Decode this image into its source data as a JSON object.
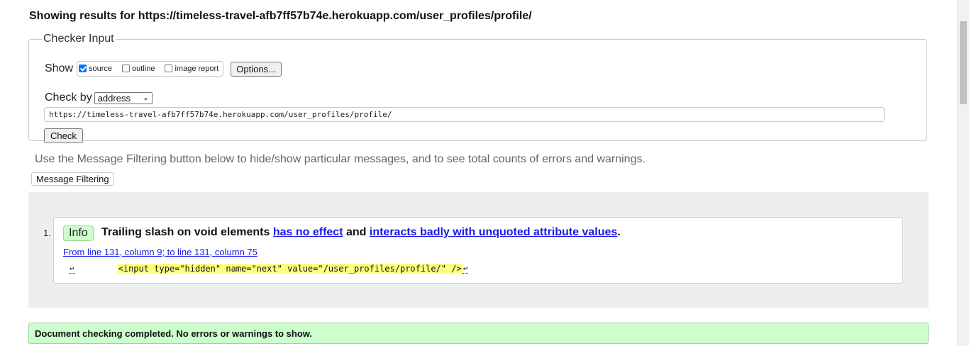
{
  "heading": {
    "prefix": "Showing results for ",
    "url": "https://timeless-travel-afb7ff57b74e.herokuapp.com/user_profiles/profile/"
  },
  "checker": {
    "legend": "Checker Input",
    "show_label": "Show",
    "options": [
      {
        "label": "source",
        "checked": true
      },
      {
        "label": "outline",
        "checked": false
      },
      {
        "label": "image report",
        "checked": false
      }
    ],
    "options_button": "Options...",
    "check_by_label": "Check by",
    "check_by_value": "address",
    "url_value": "https://timeless-travel-afb7ff57b74e.herokuapp.com/user_profiles/profile/",
    "check_button": "Check"
  },
  "filter": {
    "note": "Use the Message Filtering button below to hide/show particular messages, and to see total counts of errors and warnings.",
    "button": "Message Filtering"
  },
  "messages": [
    {
      "number": "1.",
      "type": "Info",
      "text_before": "Trailing slash on void elements ",
      "link1": "has no effect",
      "text_middle": " and ",
      "link2": "interacts badly with unquoted attribute values",
      "text_after": ".",
      "location": "From line 131, column 9; to line 131, column 75",
      "extract_newline": "↩",
      "extract_code": "<input type=\"hidden\" name=\"next\" value=\"/user_profiles/profile/\" />",
      "extract_newline_end": "↩"
    }
  ],
  "result": {
    "done_text": "Document checking completed. No errors or warnings to show."
  },
  "colors": {
    "info_badge_bg": "#ccffcc",
    "link": "#1a1ae6",
    "highlight": "#ffff80",
    "results_bg": "#eeeeee"
  }
}
